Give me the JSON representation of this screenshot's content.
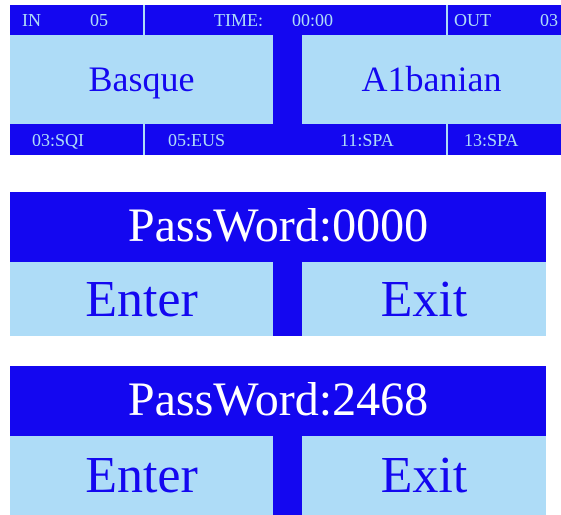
{
  "panel1": {
    "top_bar": {
      "in_label": "IN",
      "in_value": "05",
      "time_label": "TIME:",
      "time_value": "00:00",
      "out_label": "OUT",
      "out_value": "03"
    },
    "left_language": "Basque",
    "right_language": "A1banian",
    "bottom_bar": {
      "left_codes": [
        "03:SQI",
        "05:EUS"
      ],
      "right_codes": [
        "11:SPA",
        "13:SPA"
      ]
    }
  },
  "panel2": {
    "password_label": "PassWord:0000",
    "enter_label": "Enter",
    "exit_label": "Exit"
  },
  "panel3": {
    "password_label": "PassWord:2468",
    "enter_label": "Enter",
    "exit_label": "Exit"
  },
  "colors": {
    "primary_blue": "#1407f0",
    "light_blue": "#aedcf7",
    "white": "#ffffff"
  }
}
